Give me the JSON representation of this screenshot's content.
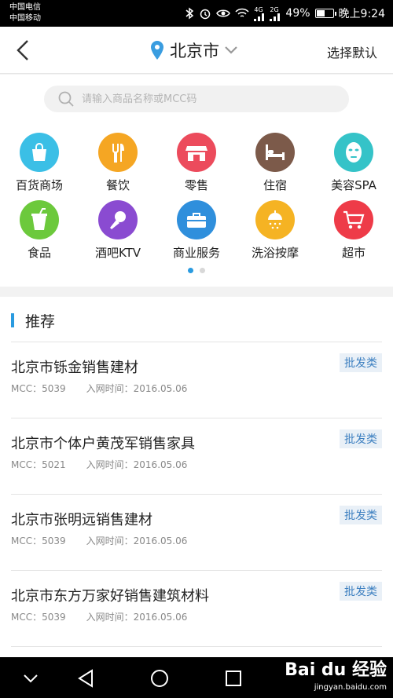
{
  "status_bar": {
    "carrier_1": "中国电信",
    "carrier_2": "中国移动",
    "network": "4G",
    "network_2": "2G",
    "battery": "49%",
    "battery_level": 0.49,
    "time": "晚上9:24"
  },
  "header": {
    "city": "北京市",
    "right_action": "选择默认"
  },
  "search": {
    "placeholder": "请输入商品名称或MCC码"
  },
  "categories": [
    {
      "label": "百货商场",
      "color": "#3bbfe6",
      "icon": "shopping-bag-icon"
    },
    {
      "label": "餐饮",
      "color": "#f5a623",
      "icon": "fork-knife-icon"
    },
    {
      "label": "零售",
      "color": "#ec4b5c",
      "icon": "storefront-icon"
    },
    {
      "label": "住宿",
      "color": "#7c5a4a",
      "icon": "bed-icon"
    },
    {
      "label": "美容SPA",
      "color": "#35c3c8",
      "icon": "face-mask-icon"
    },
    {
      "label": "食品",
      "color": "#6cc93c",
      "icon": "drink-cup-icon"
    },
    {
      "label": "酒吧KTV",
      "color": "#8a4bd1",
      "icon": "microphone-icon"
    },
    {
      "label": "商业服务",
      "color": "#2f8fdc",
      "icon": "briefcase-icon"
    },
    {
      "label": "洗浴按摩",
      "color": "#f5b323",
      "icon": "shower-icon"
    },
    {
      "label": "超市",
      "color": "#ee3b48",
      "icon": "shopping-cart-icon"
    }
  ],
  "recommend": {
    "title": "推荐",
    "items": [
      {
        "name": "北京市铄金销售建材",
        "mcc": "MCC：5039",
        "date": "入网时间：2016.05.06",
        "tag": "批发类"
      },
      {
        "name": "北京市个体户黄茂军销售家具",
        "mcc": "MCC：5021",
        "date": "入网时间：2016.05.06",
        "tag": "批发类"
      },
      {
        "name": "北京市张明远销售建材",
        "mcc": "MCC：5039",
        "date": "入网时间：2016.05.06",
        "tag": "批发类"
      },
      {
        "name": "北京市东方万家好销售建筑材料",
        "mcc": "MCC：5039",
        "date": "入网时间：2016.05.06",
        "tag": "批发类"
      }
    ]
  },
  "watermark": {
    "brand": "Bai du 经验",
    "url": "jingyan.baidu.com"
  }
}
